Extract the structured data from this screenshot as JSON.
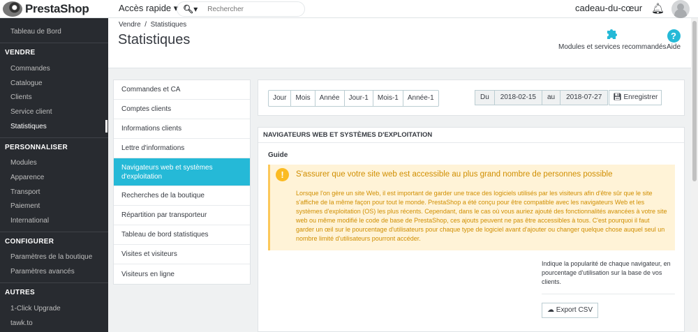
{
  "topbar": {
    "logo": "PrestaShop",
    "quick_access": "Accès rapide ▾",
    "search_placeholder": "Rechercher",
    "shop_name": "cadeau-du-cœur"
  },
  "sidebar": {
    "dashboard": "Tableau de Bord",
    "sections": [
      {
        "title": "VENDRE",
        "items": [
          "Commandes",
          "Catalogue",
          "Clients",
          "Service client",
          "Statistiques"
        ]
      },
      {
        "title": "PERSONNALISER",
        "items": [
          "Modules",
          "Apparence",
          "Transport",
          "Paiement",
          "International"
        ]
      },
      {
        "title": "CONFIGURER",
        "items": [
          "Paramètres de la boutique",
          "Paramètres avancés"
        ]
      },
      {
        "title": "AUTRES",
        "items": [
          "1-Click Upgrade",
          "tawk.to"
        ]
      }
    ],
    "active": "Statistiques"
  },
  "header": {
    "breadcrumb_parent": "Vendre",
    "breadcrumb_sep": "/",
    "breadcrumb_current": "Statistiques",
    "title": "Statistiques",
    "modules_label": "Modules et services recommandés",
    "help_label": "Aide"
  },
  "stats_menu": [
    "Commandes et CA",
    "Comptes clients",
    "Informations clients",
    "Lettre d'informations",
    "Navigateurs web et systèmes d'exploitation",
    "Recherches de la boutique",
    "Répartition par transporteur",
    "Tableau de bord statistiques",
    "Visites et visiteurs",
    "Visiteurs en ligne"
  ],
  "datebar": {
    "periods": [
      "Jour",
      "Mois",
      "Année",
      "Jour-1",
      "Mois-1",
      "Année-1"
    ],
    "from_label": "Du",
    "from_value": "2018-02-15",
    "to_label": "au",
    "to_value": "2018-07-27",
    "save_label": "Enregistrer"
  },
  "panel": {
    "heading": "NAVIGATEURS WEB ET SYSTÈMES D'EXPLOITATION",
    "guide": "Guide",
    "alert_title": "S'assurer que votre site web est accessible au plus grand nombre de personnes possible",
    "alert_text": "Lorsque l'on gère un site Web, il est important de garder une trace des logiciels utilisés par les visiteurs afin d'être sûr que le site s'affiche de la même façon pour tout le monde. PrestaShop a été conçu pour être compatible avec les navigateurs Web et les systèmes d'exploitation (OS) les plus récents. Cependant, dans le cas où vous auriez ajouté des fonctionnalités avancées à votre site web ou même modifié le code de base de PrestaShop, ces ajouts peuvent ne pas être accessibles à tous. C'est pourquoi il faut garder un œil sur le pourcentage d'utilisateurs pour chaque type de logiciel avant d'ajouter ou changer quelque chose auquel seul un nombre limité d'utilisateurs pourront accéder.",
    "indicate": "Indique la popularité de chaque navigateur, en pourcentage d'utilisation sur la base de vos clients.",
    "export_label": "Export CSV"
  },
  "colors": {
    "accent": "#25b9d7",
    "sidebar_bg": "#282b30",
    "warning_bg": "#fff3d7",
    "warning_text": "#d08e00"
  }
}
